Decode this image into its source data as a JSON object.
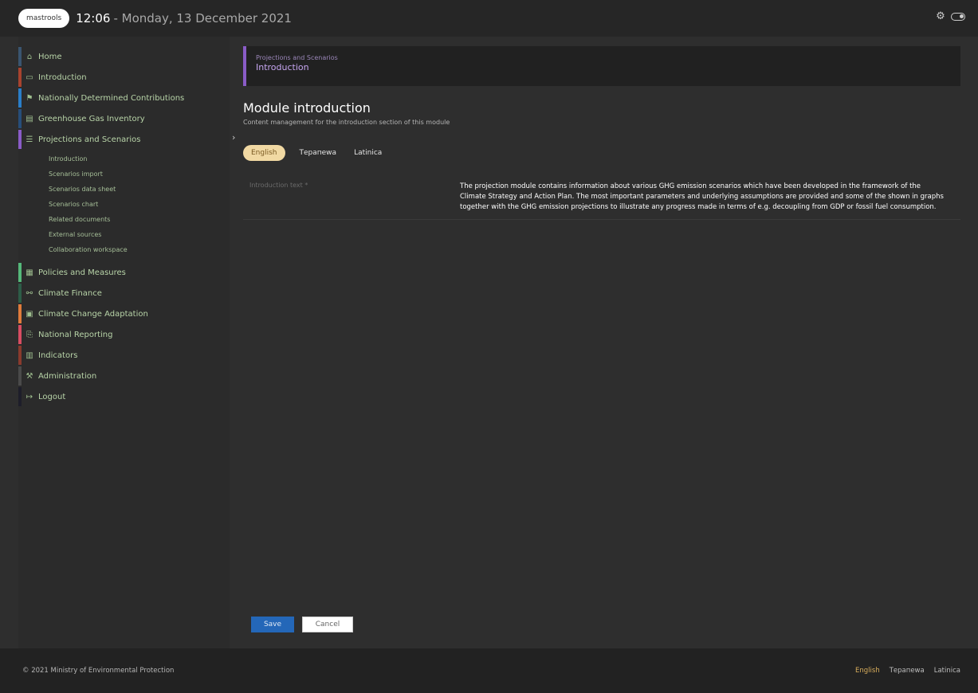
{
  "topbar": {
    "logo_text": "mastrools",
    "time": "12:06",
    "date": "- Monday, 13 December 2021"
  },
  "sidebar": {
    "items": [
      {
        "label": "Home",
        "icon": "home-icon",
        "color": "#3a5570"
      },
      {
        "label": "Introduction",
        "icon": "book-icon",
        "color": "#a8432e"
      },
      {
        "label": "Nationally Determined Contributions",
        "icon": "flag-icon",
        "color": "#2a7ec8"
      },
      {
        "label": "Greenhouse Gas Inventory",
        "icon": "calendar-icon",
        "color": "#274e7a"
      },
      {
        "label": "Projections and Scenarios",
        "icon": "list-icon",
        "color": "#8a5cc7"
      },
      {
        "label": "Policies and Measures",
        "icon": "grid-icon",
        "color": "#55b87a"
      },
      {
        "label": "Climate Finance",
        "icon": "link-icon",
        "color": "#2d5c47"
      },
      {
        "label": "Climate Change Adaptation",
        "icon": "window-icon",
        "color": "#e07b3b"
      },
      {
        "label": "National Reporting",
        "icon": "share-icon",
        "color": "#d84d62"
      },
      {
        "label": "Indicators",
        "icon": "chart-icon",
        "color": "#8a3a2d"
      },
      {
        "label": "Administration",
        "icon": "tools-icon",
        "color": "#4a4a4a"
      },
      {
        "label": "Logout",
        "icon": "logout-icon",
        "color": "#1e1e2a"
      }
    ],
    "subitems": [
      "Introduction",
      "Scenarios import",
      "Scenarios data sheet",
      "Scenarios chart",
      "Related documents",
      "External sources",
      "Collaboration workspace"
    ]
  },
  "breadcrumb": {
    "parent": "Projections and Scenarios",
    "current": "Introduction"
  },
  "main": {
    "title": "Module introduction",
    "subtitle": "Content management for the introduction section of this module",
    "lang_tabs": [
      "English",
      "Терапеwа",
      "Latinica"
    ],
    "field_label": "Introduction text *",
    "field_value": "The projection module contains information about various GHG emission scenarios which have been developed in the framework of the Climate Strategy and Action Plan. The most important parameters and underlying assumptions are provided and some of the shown in graphs together with the GHG emission projections to illustrate any progress made in terms of e.g. decoupling from GDP or fossil fuel consumption.",
    "save_label": "Save",
    "cancel_label": "Cancel"
  },
  "footer": {
    "copyright": "© 2021 Ministry of Environmental Protection",
    "langs": [
      "English",
      "Терапеwа",
      "Latinica"
    ]
  },
  "colors": {
    "accent_purple": "#8a5cc7",
    "save_blue": "#2467b8",
    "active_tab": "#f1d9a3"
  }
}
